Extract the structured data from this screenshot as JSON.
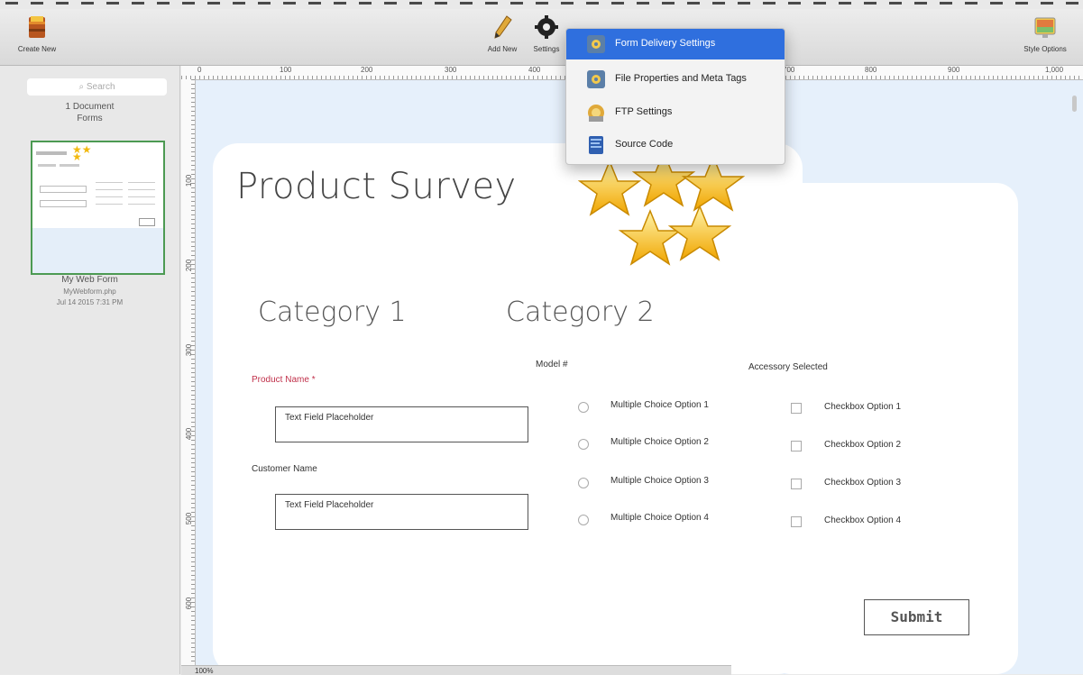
{
  "toolbar": {
    "create_new": "Create New",
    "add_new": "Add New",
    "settings": "Settings",
    "style_options": "Style Options"
  },
  "sidebar": {
    "search_placeholder": "Search",
    "count_line1": "1 Document",
    "count_line2": "Forms",
    "doc_name": "My Web Form",
    "doc_file": "MyWebform.php",
    "doc_date": "Jul 14 2015 7:31 PM"
  },
  "ruler": {
    "h_labels": [
      "0",
      "100",
      "200",
      "300",
      "400",
      "700",
      "800",
      "900",
      "1,000"
    ],
    "v_labels": [
      "100",
      "200",
      "300",
      "400",
      "500",
      "600"
    ]
  },
  "form": {
    "title": "Product Survey",
    "category1": "Category 1",
    "category2": "Category 2",
    "product_name_label": "Product Name *",
    "product_name_placeholder": "Text Field Placeholder",
    "customer_name_label": "Customer Name",
    "customer_name_placeholder": "Text Field Placeholder",
    "model_label": "Model #",
    "accessory_label": "Accessory Selected",
    "radio_options": [
      "Multiple Choice Option 1",
      "Multiple Choice Option 2",
      "Multiple Choice Option 3",
      "Multiple Choice Option 4"
    ],
    "checkbox_options": [
      "Checkbox Option 1",
      "Checkbox Option 2",
      "Checkbox Option 3",
      "Checkbox Option 4"
    ],
    "submit": "Submit"
  },
  "settings_menu": {
    "items": [
      "Form Delivery Settings",
      "File Properties and Meta Tags",
      "FTP Settings",
      "Source Code"
    ],
    "selected": "Form Delivery Settings"
  },
  "zoom": "100%",
  "colors": {
    "selection": "#2f6fde",
    "thumbnail_border": "#4c9a52",
    "required_label": "#c0304a",
    "canvas_bg": "#e6f0fb"
  }
}
